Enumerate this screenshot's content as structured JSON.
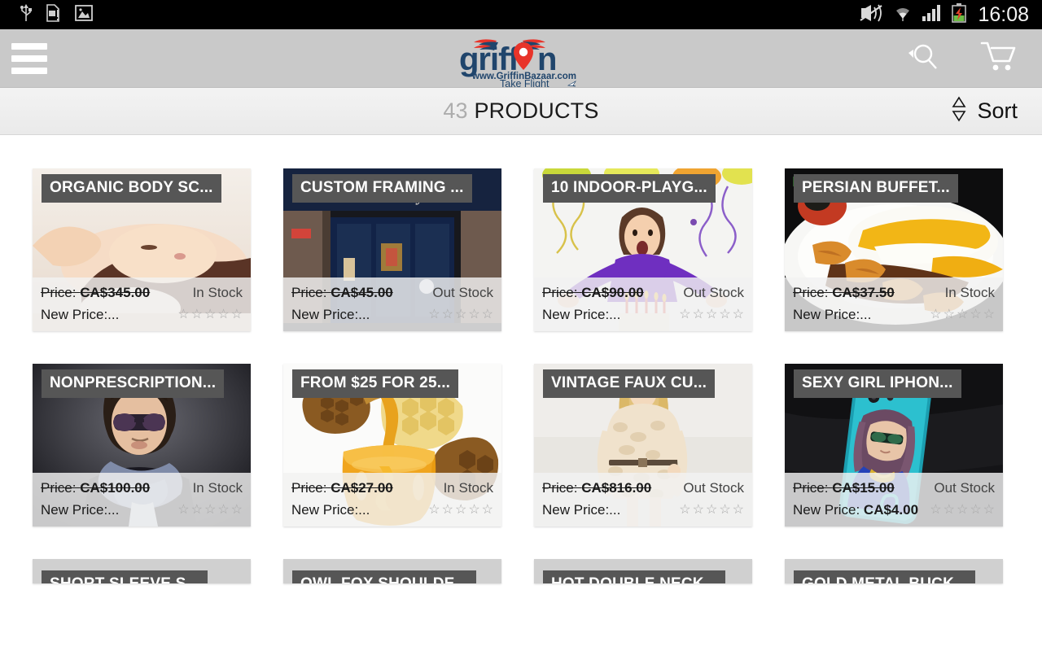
{
  "statusbar": {
    "time": "16:08",
    "icons_left": [
      "usb-icon",
      "sd-card-alert-icon",
      "image-icon"
    ],
    "icons_right": [
      "vibrate-off-icon",
      "wifi-icon",
      "signal-bars-icon",
      "battery-charging-icon"
    ]
  },
  "appbar": {
    "menu_icon": "hamburger-menu-icon",
    "logo": {
      "wordmark": "griffin",
      "url_line": "www.GriffinBazaar.com",
      "tagline": "Take Flight",
      "brand_navy": "#20456c",
      "brand_red": "#e8342a"
    },
    "search_icon": "search-icon",
    "cart_icon": "shopping-cart-icon",
    "background": "#c9c9c9"
  },
  "countbar": {
    "count": "43",
    "label": "PRODUCTS",
    "sort_label": "Sort",
    "sort_icon": "sort-updown-icon"
  },
  "products": [
    {
      "title": "ORGANIC BODY SC...",
      "price_label": "Price:",
      "price": "CA$345.00",
      "stock": "In Stock",
      "new_price_label": "New Price:...",
      "new_price": "",
      "rating": 0,
      "image": "woman-receiving-head-massage-spa"
    },
    {
      "title": "CUSTOM FRAMING ...",
      "price_label": "Price:",
      "price": "CA$45.00",
      "stock": "Out Stock",
      "new_price_label": "New Price:...",
      "new_price": "",
      "rating": 0,
      "image": "art-gallery-storefront-at-night"
    },
    {
      "title": "10 INDOOR-PLAYG...",
      "price_label": "Price:",
      "price": "CA$90.00",
      "stock": "Out Stock",
      "new_price_label": "New Price:...",
      "new_price": "",
      "rating": 0,
      "image": "girl-at-birthday-party-with-streamers"
    },
    {
      "title": "PERSIAN  BUFFET...",
      "price_label": "Price:",
      "price": "CA$37.50",
      "stock": "In Stock",
      "new_price_label": "New Price:...",
      "new_price": "",
      "rating": 0,
      "image": "persian-kebab-saffron-rice-plate"
    },
    {
      "title": "NONPRESCRIPTION...",
      "price_label": "Price:",
      "price": "CA$100.00",
      "stock": "In Stock",
      "new_price_label": "New Price:...",
      "new_price": "",
      "rating": 0,
      "image": "man-wearing-sunglasses-and-scarf"
    },
    {
      "title": "FROM  $25 FOR 25...",
      "price_label": "Price:",
      "price": "CA$27.00",
      "stock": "In Stock",
      "new_price_label": "New Price:...",
      "new_price": "",
      "rating": 0,
      "image": "honey-jar-with-dipper-and-honeycomb"
    },
    {
      "title": "VINTAGE FAUX CU...",
      "price_label": "Price:",
      "price": "CA$816.00",
      "stock": "Out Stock",
      "new_price_label": "New Price:...",
      "new_price": "",
      "rating": 0,
      "image": "woman-in-cream-faux-fur-coat"
    },
    {
      "title": "SEXY GIRL IPHON...",
      "price_label": "Price:",
      "price": "CA$15.00",
      "stock": "Out Stock",
      "new_price_label": "New Price:",
      "new_price": "CA$4.00",
      "rating": 0,
      "image": "iphone-case-illustrated-girl-sunglasses"
    }
  ],
  "products_partial": [
    {
      "title": "SHORT SLEEVE S..."
    },
    {
      "title": "OWL FOX SHOULDE..."
    },
    {
      "title": "HOT DOUBLE NECK..."
    },
    {
      "title": "GOLD METAL BUCK..."
    }
  ]
}
